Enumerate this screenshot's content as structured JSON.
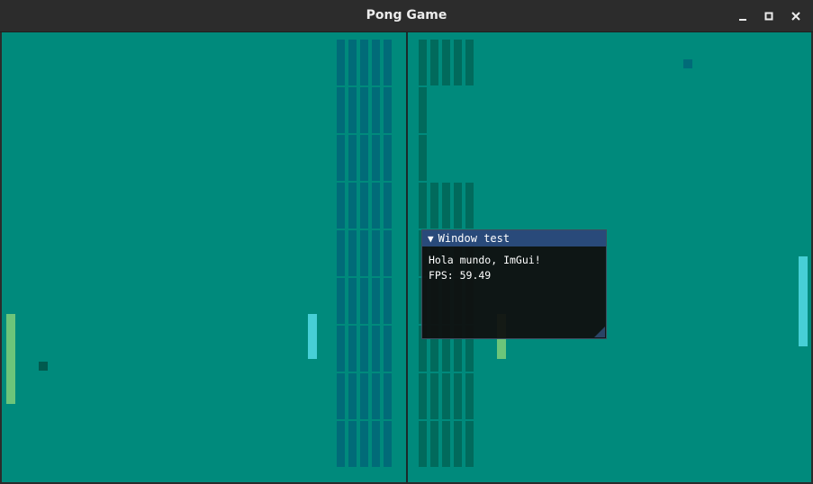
{
  "window": {
    "title": "Pong Game",
    "buttons": [
      "minimize",
      "maximize",
      "close"
    ]
  },
  "game": {
    "background_color": "#008a7c",
    "left_block_color": "#016b78",
    "right_block_color": "#016a5c",
    "paddle_green_color": "#6cc57a",
    "paddle_cyan_color": "#47cfd6"
  },
  "imgui": {
    "title": "Window test",
    "arrow": "▼",
    "lines": [
      "Hola mundo, ImGui!",
      "FPS: 59.49"
    ]
  }
}
